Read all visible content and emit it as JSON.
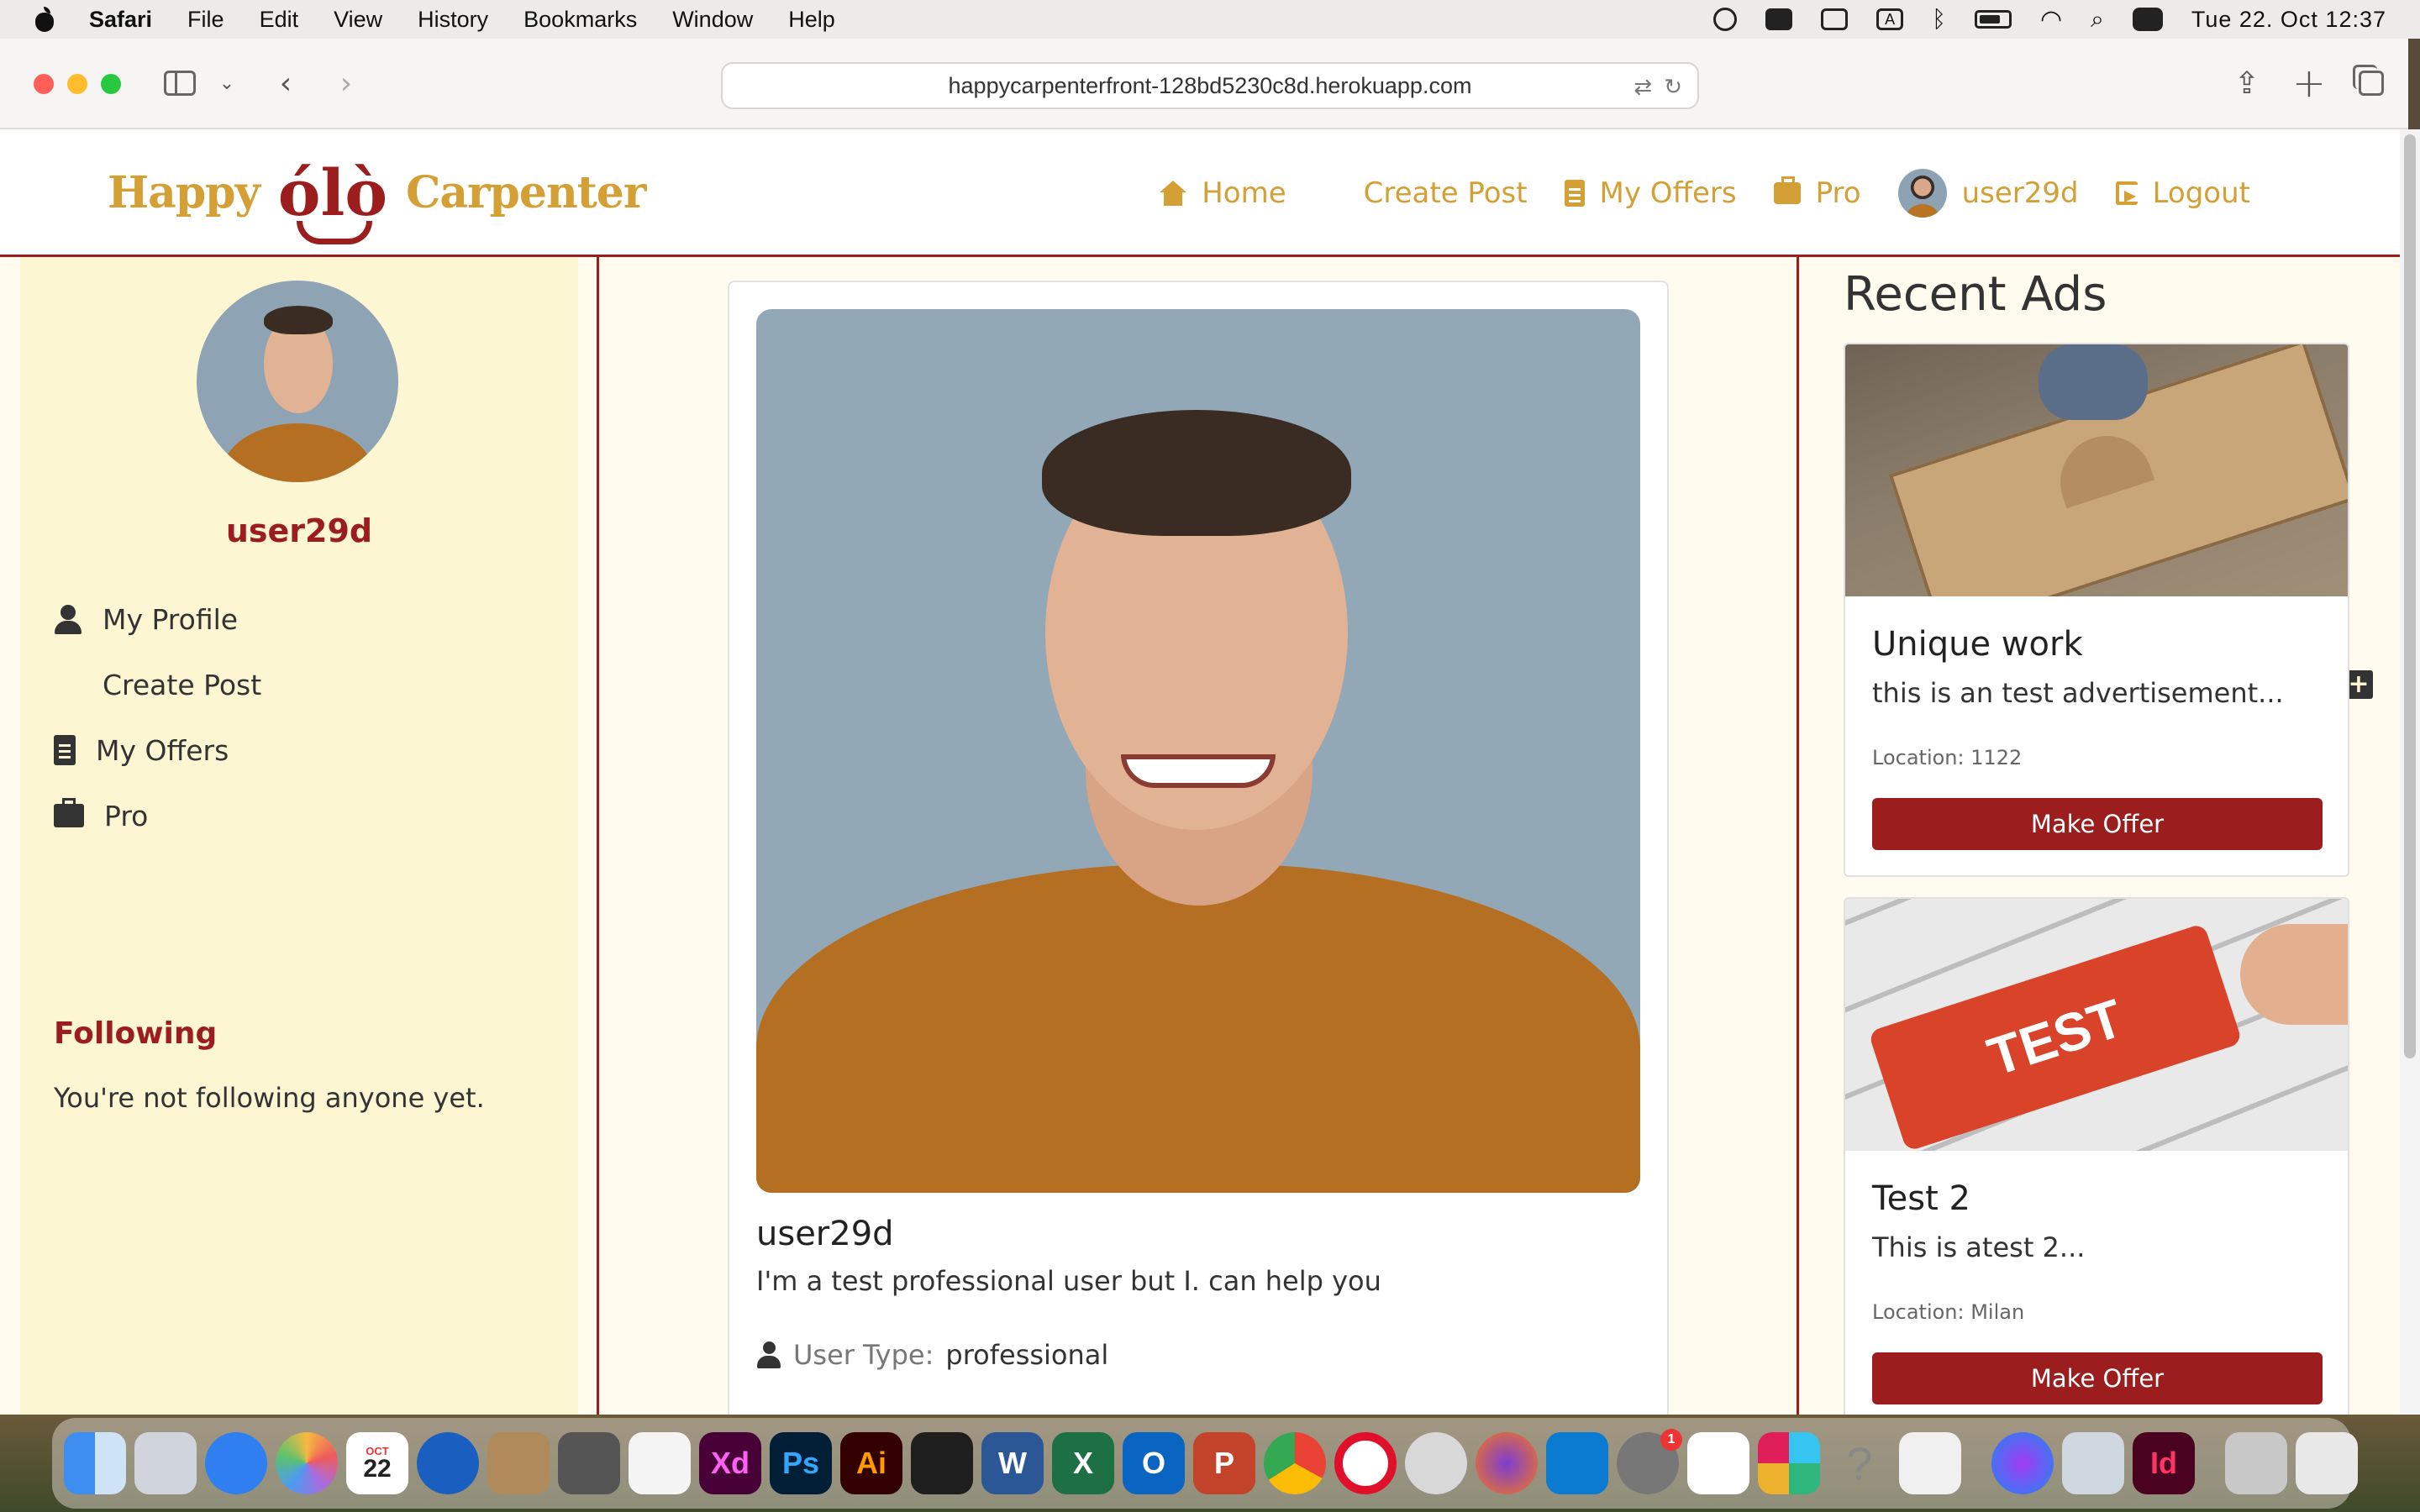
{
  "menubar": {
    "app": "Safari",
    "items": [
      "File",
      "Edit",
      "View",
      "History",
      "Bookmarks",
      "Window",
      "Help"
    ],
    "clock": "Tue 22. Oct  12:37",
    "status_icons": [
      "creative-cloud-icon",
      "drive-icon",
      "screen-mirror-icon",
      "input-source-icon",
      "bluetooth-icon",
      "battery-icon",
      "wifi-icon",
      "spotlight-icon",
      "control-center-icon"
    ]
  },
  "browser": {
    "url": "happycarpenterfront-128bd5230c8d.herokuapp.com"
  },
  "site": {
    "logo": {
      "left": "Happy",
      "mid": "ólò",
      "right": "Carpenter"
    },
    "nav": {
      "home": "Home",
      "create_post": "Create Post",
      "my_offers": "My Offers",
      "pro": "Pro",
      "username": "user29d",
      "logout": "Logout"
    },
    "accent": "#9b1d1d",
    "gold": "#d4a035"
  },
  "sidebar": {
    "username": "user29d",
    "menu": [
      "My Profile",
      "Create Post",
      "My Offers",
      "Pro"
    ],
    "following_heading": "Following",
    "following_text": "You're not following anyone yet."
  },
  "profile": {
    "name": "user29d",
    "bio": "I'm a test professional user but I. can help you",
    "user_type_label": "User Type:",
    "user_type_value": "professional"
  },
  "recent_ads": {
    "heading": "Recent Ads",
    "ads": [
      {
        "title": "Unique work",
        "desc": "this is an test advertisement...",
        "location": "Location: 1122",
        "button": "Make Offer"
      },
      {
        "title": "Test 2",
        "desc": "This is atest 2...",
        "location": "Location: Milan",
        "button": "Make Offer",
        "image_text": "TEST"
      }
    ]
  },
  "dock": {
    "calendar_month": "OCT",
    "calendar_day": "22",
    "apps": [
      "finder-icon",
      "launchpad-icon",
      "safari-icon",
      "photos-icon",
      "calendar-icon",
      "thunderbird-icon",
      "contacts-icon",
      "calculator-icon",
      "textedit-icon",
      "xd-icon",
      "photoshop-icon",
      "illustrator-icon",
      "figma-icon",
      "word-icon",
      "excel-icon",
      "outlook-icon",
      "powerpoint-icon",
      "chrome-icon",
      "opera-icon",
      "whatsapp-icon",
      "firefox-icon",
      "vscode-icon",
      "system-settings-icon",
      "capcut-icon",
      "slack-icon",
      "help-icon",
      "freeform-icon",
      "messenger-icon",
      "preview-icon",
      "indesign-icon",
      "downloads-icon",
      "trash-icon"
    ],
    "labels": {
      "xd": "Xd",
      "ps": "Ps",
      "ai": "Ai",
      "word": "W",
      "excel": "X",
      "outlook": "O",
      "ppt": "P",
      "id": "Id",
      "help": "?",
      "badge": "1"
    }
  }
}
